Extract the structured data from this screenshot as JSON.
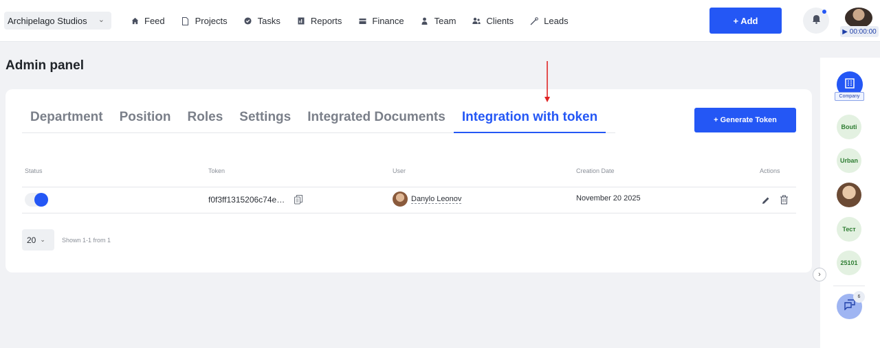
{
  "header": {
    "company": "Archipelago Studios",
    "nav": [
      {
        "label": "Feed",
        "icon": "home-icon"
      },
      {
        "label": "Projects",
        "icon": "document-icon"
      },
      {
        "label": "Tasks",
        "icon": "check-circle-icon"
      },
      {
        "label": "Reports",
        "icon": "report-icon"
      },
      {
        "label": "Finance",
        "icon": "wallet-icon"
      },
      {
        "label": "Team",
        "icon": "person-icon"
      },
      {
        "label": "Clients",
        "icon": "people-icon"
      },
      {
        "label": "Leads",
        "icon": "handshake-icon"
      }
    ],
    "add_label": "+ Add",
    "timer": "▶ 00:00:00"
  },
  "page": {
    "title": "Admin panel"
  },
  "tabs": [
    {
      "label": "Department",
      "active": false
    },
    {
      "label": "Position",
      "active": false
    },
    {
      "label": "Roles",
      "active": false
    },
    {
      "label": "Settings",
      "active": false
    },
    {
      "label": "Integrated Documents",
      "active": false
    },
    {
      "label": "Integration with token",
      "active": true
    }
  ],
  "generate_label": "+ Generate Token",
  "table": {
    "headers": {
      "status": "Status",
      "token": "Token",
      "user": "User",
      "date": "Creation Date",
      "actions": "Actions"
    },
    "rows": [
      {
        "status_on": true,
        "token": "f0f3ff1315206c74e…",
        "user": "Danylo Leonov",
        "date": "November 20 2025"
      }
    ]
  },
  "pagination": {
    "per_page": "20",
    "shown": "Shown 1-1 from 1"
  },
  "rail": {
    "company_label": "Company",
    "workspaces": [
      "Bouti",
      "Urban",
      "Тест",
      "25101"
    ],
    "chat_badge": "6"
  },
  "colors": {
    "accent": "#2457f5",
    "arrow": "#e02424"
  }
}
